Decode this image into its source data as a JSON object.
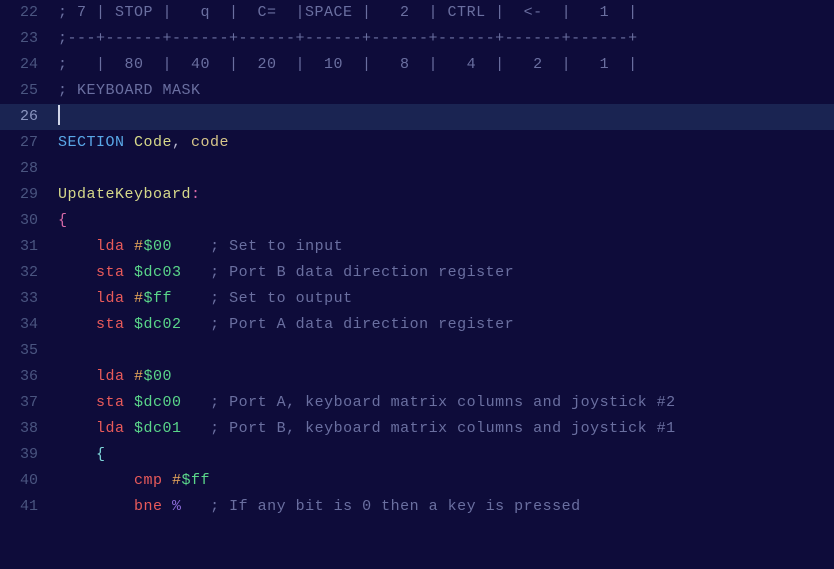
{
  "lines": [
    {
      "num": "22",
      "current": false,
      "tokens": [
        {
          "cls": "c-comment",
          "t": "; 7 | STOP |   q  |  C=  |SPACE |   2  | CTRL |  <-  |   1  |"
        }
      ]
    },
    {
      "num": "23",
      "current": false,
      "tokens": [
        {
          "cls": "c-comment",
          "t": ";---+------+------+------+------+------+------+------+------+"
        }
      ]
    },
    {
      "num": "24",
      "current": false,
      "tokens": [
        {
          "cls": "c-comment",
          "t": ";   |  80  |  40  |  20  |  10  |   8  |   4  |   2  |   1  |"
        }
      ]
    },
    {
      "num": "25",
      "current": false,
      "tokens": [
        {
          "cls": "c-comment",
          "t": "; KEYBOARD MASK"
        }
      ]
    },
    {
      "num": "26",
      "current": true,
      "tokens": []
    },
    {
      "num": "27",
      "current": false,
      "tokens": [
        {
          "cls": "c-keyword",
          "t": "SECTION "
        },
        {
          "cls": "c-ident",
          "t": "Code"
        },
        {
          "cls": "c-comma",
          "t": ", "
        },
        {
          "cls": "c-ident2",
          "t": "code"
        }
      ]
    },
    {
      "num": "28",
      "current": false,
      "tokens": []
    },
    {
      "num": "29",
      "current": false,
      "tokens": [
        {
          "cls": "c-ident",
          "t": "UpdateKeyboard"
        },
        {
          "cls": "c-punct2",
          "t": ":"
        }
      ]
    },
    {
      "num": "30",
      "current": false,
      "tokens": [
        {
          "cls": "c-punct2",
          "t": "{"
        }
      ]
    },
    {
      "num": "31",
      "current": false,
      "tokens": [
        {
          "cls": "",
          "t": "    "
        },
        {
          "cls": "c-red",
          "t": "lda "
        },
        {
          "cls": "c-orange",
          "t": "#"
        },
        {
          "cls": "c-green",
          "t": "$00"
        },
        {
          "cls": "",
          "t": "    "
        },
        {
          "cls": "c-comment",
          "t": "; Set to input"
        }
      ]
    },
    {
      "num": "32",
      "current": false,
      "tokens": [
        {
          "cls": "",
          "t": "    "
        },
        {
          "cls": "c-red",
          "t": "sta "
        },
        {
          "cls": "c-green",
          "t": "$dc03"
        },
        {
          "cls": "",
          "t": "   "
        },
        {
          "cls": "c-comment",
          "t": "; Port B data direction register"
        }
      ]
    },
    {
      "num": "33",
      "current": false,
      "tokens": [
        {
          "cls": "",
          "t": "    "
        },
        {
          "cls": "c-red",
          "t": "lda "
        },
        {
          "cls": "c-orange",
          "t": "#"
        },
        {
          "cls": "c-green",
          "t": "$ff"
        },
        {
          "cls": "",
          "t": "    "
        },
        {
          "cls": "c-comment",
          "t": "; Set to output"
        }
      ]
    },
    {
      "num": "34",
      "current": false,
      "tokens": [
        {
          "cls": "",
          "t": "    "
        },
        {
          "cls": "c-red",
          "t": "sta "
        },
        {
          "cls": "c-green",
          "t": "$dc02"
        },
        {
          "cls": "",
          "t": "   "
        },
        {
          "cls": "c-comment",
          "t": "; Port A data direction register"
        }
      ]
    },
    {
      "num": "35",
      "current": false,
      "tokens": []
    },
    {
      "num": "36",
      "current": false,
      "tokens": [
        {
          "cls": "",
          "t": "    "
        },
        {
          "cls": "c-red",
          "t": "lda "
        },
        {
          "cls": "c-orange",
          "t": "#"
        },
        {
          "cls": "c-green",
          "t": "$00"
        }
      ]
    },
    {
      "num": "37",
      "current": false,
      "tokens": [
        {
          "cls": "",
          "t": "    "
        },
        {
          "cls": "c-red",
          "t": "sta "
        },
        {
          "cls": "c-green",
          "t": "$dc00"
        },
        {
          "cls": "",
          "t": "   "
        },
        {
          "cls": "c-comment",
          "t": "; Port A, keyboard matrix columns and joystick #2"
        }
      ]
    },
    {
      "num": "38",
      "current": false,
      "tokens": [
        {
          "cls": "",
          "t": "    "
        },
        {
          "cls": "c-red",
          "t": "lda "
        },
        {
          "cls": "c-green",
          "t": "$dc01"
        },
        {
          "cls": "",
          "t": "   "
        },
        {
          "cls": "c-comment",
          "t": "; Port B, keyboard matrix columns and joystick #1"
        }
      ]
    },
    {
      "num": "39",
      "current": false,
      "tokens": [
        {
          "cls": "",
          "t": "    "
        },
        {
          "cls": "c-punct",
          "t": "{"
        }
      ]
    },
    {
      "num": "40",
      "current": false,
      "tokens": [
        {
          "cls": "",
          "t": "        "
        },
        {
          "cls": "c-red",
          "t": "cmp "
        },
        {
          "cls": "c-orange",
          "t": "#"
        },
        {
          "cls": "c-green",
          "t": "$ff"
        }
      ]
    },
    {
      "num": "41",
      "current": false,
      "tokens": [
        {
          "cls": "",
          "t": "        "
        },
        {
          "cls": "c-red",
          "t": "bne "
        },
        {
          "cls": "c-pct",
          "t": "%"
        },
        {
          "cls": "",
          "t": "   "
        },
        {
          "cls": "c-comment",
          "t": "; If any bit is 0 then a key is pressed"
        }
      ]
    }
  ]
}
